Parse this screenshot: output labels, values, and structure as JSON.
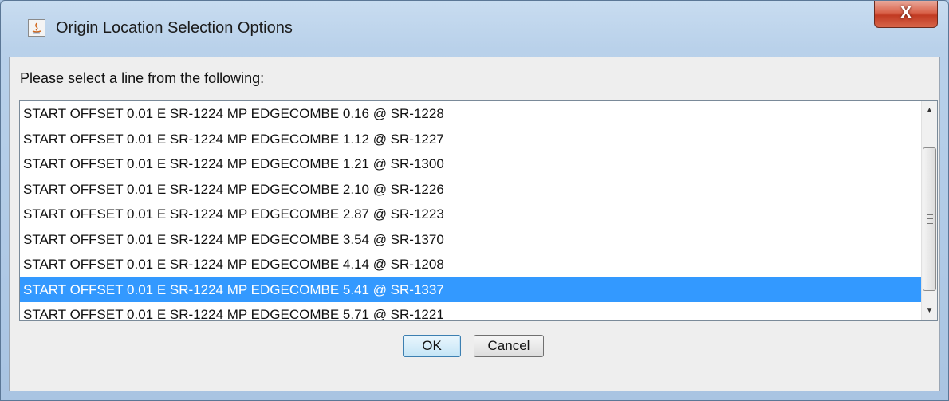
{
  "window": {
    "title": "Origin Location Selection Options",
    "app_icon": "java-icon",
    "close_symbol": "X"
  },
  "dialog": {
    "prompt": "Please select a line from the following:",
    "items": [
      "START OFFSET 0.01 E SR-1224 MP EDGECOMBE 0.16 @ SR-1228",
      "START OFFSET 0.01 E SR-1224 MP EDGECOMBE 1.12 @ SR-1227",
      "START OFFSET 0.01 E SR-1224 MP EDGECOMBE 1.21 @ SR-1300",
      "START OFFSET 0.01 E SR-1224 MP EDGECOMBE 2.10 @ SR-1226",
      "START OFFSET 0.01 E SR-1224 MP EDGECOMBE 2.87 @ SR-1223",
      "START OFFSET 0.01 E SR-1224 MP EDGECOMBE 3.54 @ SR-1370",
      "START OFFSET 0.01 E SR-1224 MP EDGECOMBE 4.14 @ SR-1208",
      "START OFFSET 0.01 E SR-1224 MP EDGECOMBE 5.41 @ SR-1337",
      "START OFFSET 0.01 E SR-1224 MP EDGECOMBE 5.71 @ SR-1221"
    ],
    "selected_index": 7,
    "ok_label": "OK",
    "cancel_label": "Cancel"
  },
  "colors": {
    "selection": "#3399ff",
    "close_button": "#c13a22",
    "titlebar": "#b9d1ea"
  }
}
